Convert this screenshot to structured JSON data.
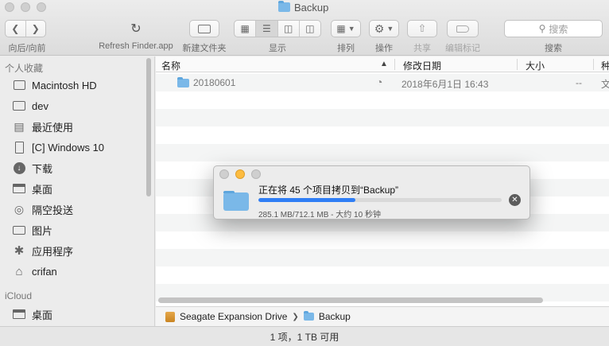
{
  "window": {
    "title": "Backup"
  },
  "toolbar": {
    "nav_label": "向后/向前",
    "refresh_label": "Refresh Finder.app",
    "new_folder_label": "新建文件夹",
    "view_label": "显示",
    "arrange_label": "排列",
    "action_label": "操作",
    "share_label": "共享",
    "tags_label": "编辑标记",
    "search_placeholder": "搜索",
    "search_label": "搜索",
    "view_selected": "list"
  },
  "sidebar": {
    "favorites_header": "个人收藏",
    "items": [
      {
        "label": "Macintosh HD",
        "icon": "hard-drive-icon"
      },
      {
        "label": "dev",
        "icon": "folder-icon"
      },
      {
        "label": "最近使用",
        "icon": "recents-icon"
      },
      {
        "label": "[C] Windows 10",
        "icon": "document-icon"
      },
      {
        "label": "下载",
        "icon": "downloads-icon"
      },
      {
        "label": "桌面",
        "icon": "desktop-icon"
      },
      {
        "label": "隔空投送",
        "icon": "airdrop-icon"
      },
      {
        "label": "图片",
        "icon": "camera-icon"
      },
      {
        "label": "应用程序",
        "icon": "applications-icon"
      },
      {
        "label": "crifan",
        "icon": "home-icon"
      }
    ],
    "icloud_header": "iCloud",
    "icloud_items": [
      {
        "label": "桌面",
        "icon": "desktop-icon"
      }
    ]
  },
  "columns": {
    "name": "名称",
    "modified": "修改日期",
    "size": "大小",
    "kind": "种"
  },
  "files": [
    {
      "name": "20180601",
      "modified": "2018年6月1日 16:43",
      "size": "--",
      "kind": "文"
    }
  ],
  "pathbar": {
    "drive": "Seagate Expansion Drive",
    "folder": "Backup"
  },
  "status": {
    "text": "1 项，1 TB 可用"
  },
  "copy_dialog": {
    "title": "正在将 45 个项目拷贝到“Backup”",
    "detail": "285.1 MB/712.1 MB - 大约 10 秒钟",
    "progress": 0.4
  },
  "colors": {
    "accent": "#2f7ef5",
    "folder": "#7ab8e8",
    "close": "#fc615d",
    "minimize": "#fdbc40",
    "inactive": "#cfcfcf"
  }
}
